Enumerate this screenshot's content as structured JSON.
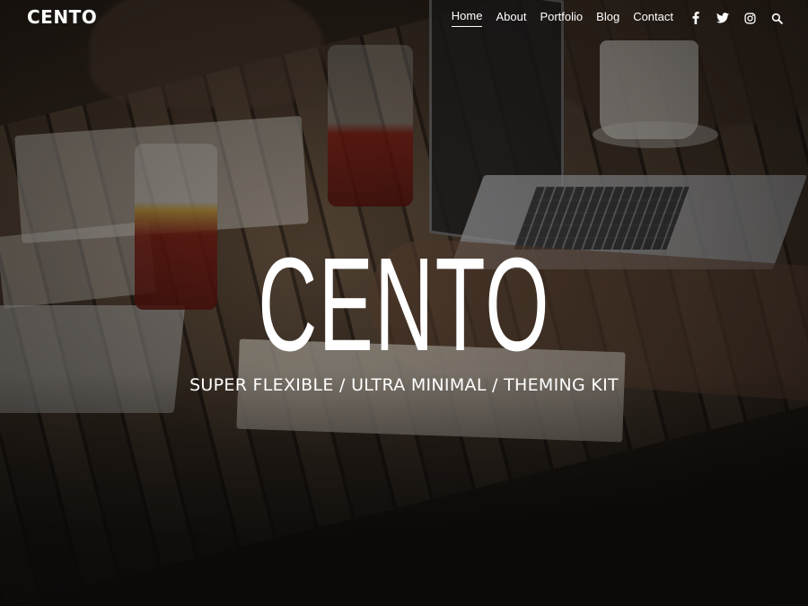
{
  "site": {
    "logo": "CENTO"
  },
  "nav": {
    "items": [
      {
        "label": "Home",
        "active": true
      },
      {
        "label": "About",
        "active": false
      },
      {
        "label": "Portfolio",
        "active": false
      },
      {
        "label": "Blog",
        "active": false
      },
      {
        "label": "Contact",
        "active": false
      }
    ],
    "icons": [
      "facebook-icon",
      "twitter-icon",
      "instagram-icon",
      "search-icon"
    ]
  },
  "hero": {
    "title": "CENTO",
    "subtitle": "SUPER FLEXIBLE / ULTRA MINIMAL / THEMING KIT"
  },
  "colors": {
    "text": "#ffffff",
    "overlay": "#000000"
  }
}
